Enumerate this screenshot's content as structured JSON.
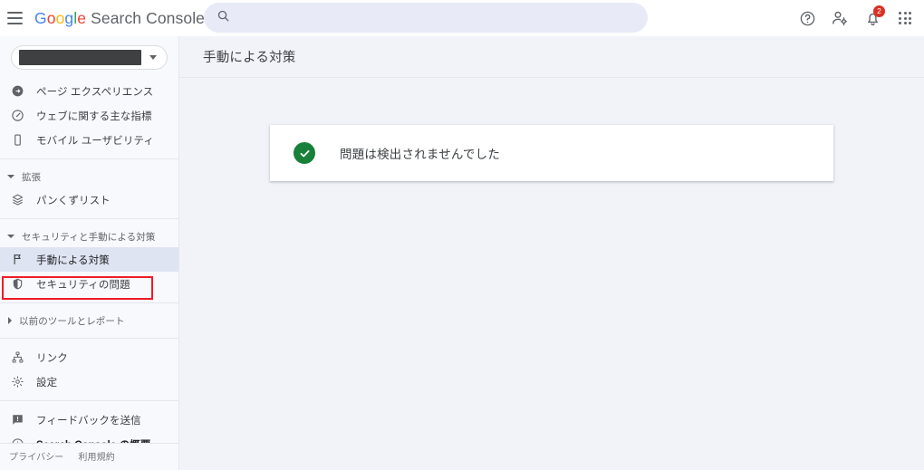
{
  "header": {
    "menu_icon": "hamburger-menu-icon",
    "brand_google": "Google",
    "brand_suffix": "Search Console",
    "google_letters": [
      {
        "ch": "G",
        "color": "#4285f4"
      },
      {
        "ch": "o",
        "color": "#ea4335"
      },
      {
        "ch": "o",
        "color": "#fbbc05"
      },
      {
        "ch": "g",
        "color": "#4285f4"
      },
      {
        "ch": "l",
        "color": "#34a853"
      },
      {
        "ch": "e",
        "color": "#ea4335"
      }
    ],
    "search": {
      "value": "",
      "placeholder": "",
      "icon": "search-icon"
    },
    "actions": {
      "help": "help-icon",
      "account_settings": "account-settings-icon",
      "notifications": "notifications-bell-icon",
      "notification_count": "2",
      "apps": "apps-grid-icon"
    }
  },
  "sidebar": {
    "property_selector": {
      "value": "",
      "redacted": true
    },
    "items": [
      {
        "label": "ページ エクスペリエンス",
        "icon": "page-experience-icon"
      },
      {
        "label": "ウェブに関する主な指標",
        "icon": "core-web-vitals-gauge-icon"
      },
      {
        "label": "モバイル ユーザビリティ",
        "icon": "mobile-device-icon"
      }
    ],
    "group_enhancements": {
      "label": "拡張",
      "expanded": true
    },
    "enhancement_items": [
      {
        "label": "パンくずリスト",
        "icon": "breadcrumbs-layers-icon"
      }
    ],
    "group_security": {
      "label": "セキュリティと手動による対策",
      "expanded": true
    },
    "security_items": [
      {
        "label": "手動による対策",
        "icon": "flag-icon",
        "selected": true,
        "highlighted": true
      },
      {
        "label": "セキュリティの問題",
        "icon": "shield-icon",
        "selected": false,
        "highlighted": false
      }
    ],
    "group_legacy": {
      "label": "以前のツールとレポート",
      "expanded": false
    },
    "tools": [
      {
        "label": "リンク",
        "icon": "links-hierarchy-icon"
      },
      {
        "label": "設定",
        "icon": "settings-gear-icon"
      }
    ],
    "support": [
      {
        "label": "フィードバックを送信",
        "icon": "feedback-icon",
        "bold": false
      },
      {
        "label": "Search Console の概要",
        "icon": "info-circle-icon",
        "bold": true
      }
    ],
    "footer_links": [
      "プライバシー",
      "利用規約"
    ]
  },
  "main": {
    "page_title": "手動による対策",
    "status_card": {
      "icon": "green-check-circle-icon",
      "message": "問題は検出されませんでした"
    }
  },
  "colors": {
    "accent_blue": "#4285f4",
    "success_green": "#188038",
    "alert_red": "#d93025",
    "highlight_red": "#ee1c25",
    "selected_bg": "#dfe4f3",
    "page_bg": "#f1f3f9",
    "sidebar_bg": "#f8f9fd"
  }
}
